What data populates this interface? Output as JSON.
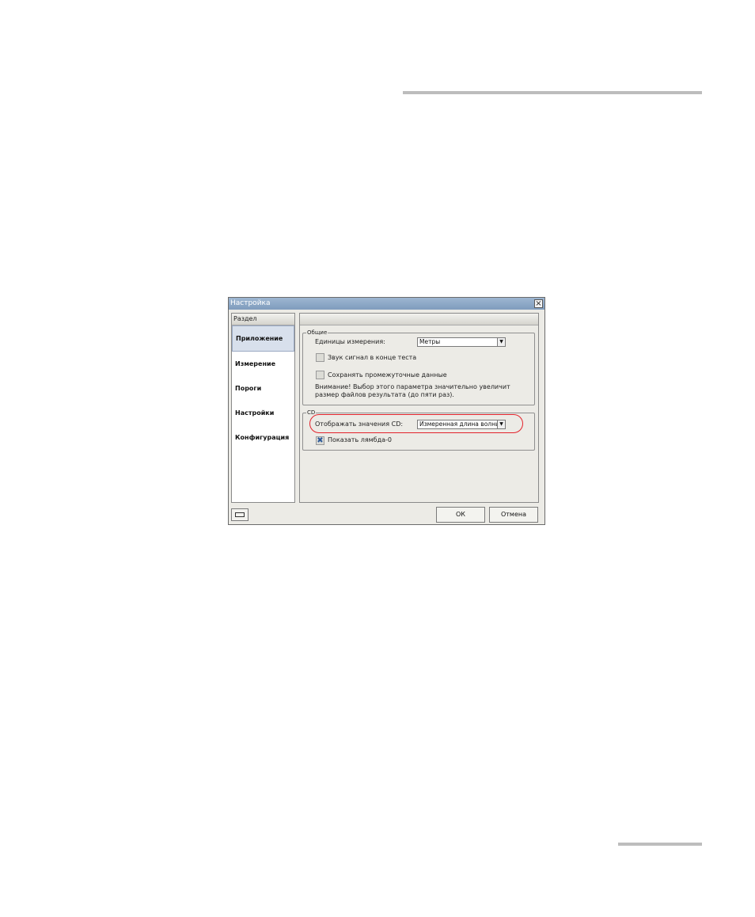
{
  "dialog": {
    "title": "Настройка",
    "close_symbol": "×"
  },
  "sidebar": {
    "header": "Раздел",
    "items": [
      {
        "label": "Приложение",
        "selected": true
      },
      {
        "label": "Измерение",
        "selected": false
      },
      {
        "label": "Пороги",
        "selected": false
      },
      {
        "label": "Настройки",
        "selected": false
      },
      {
        "label": "Конфигурация",
        "selected": false
      }
    ]
  },
  "general_group": {
    "legend": "Общие",
    "units_label": "Единицы измерения:",
    "units_value": "Метры",
    "sound_label": "Звук сигнал в конце теста",
    "sound_checked": false,
    "save_intermediate_label": "Сохранять промежуточные данные",
    "save_intermediate_checked": false,
    "warning_line1": "Внимание! Выбор этого параметра значительно увеличит",
    "warning_line2": "размер файлов результата (до пяти раз)."
  },
  "cd_group": {
    "legend": "CD",
    "display_label": "Отображать значения CD:",
    "display_value": "Измеренная длина волнь",
    "show_lambda_label": "Показать лямбда-0",
    "show_lambda_checked": true,
    "check_mark": "✖"
  },
  "footer": {
    "ok_label": "ОК",
    "cancel_label": "Отмена"
  },
  "icons": {
    "dropdown": "▼"
  },
  "colors": {
    "highlight": "#e3222b",
    "titlebar": "#8fa9c8",
    "selected_item": "#d8e0ec"
  }
}
